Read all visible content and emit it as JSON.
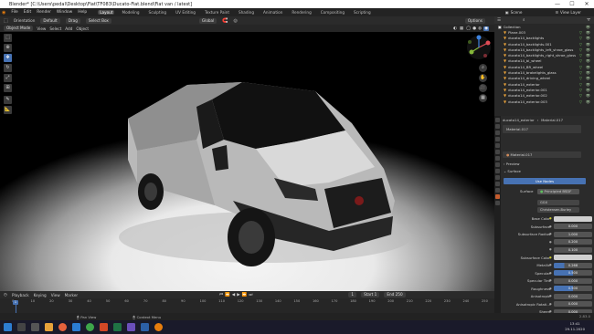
{
  "titlebar": {
    "title": "Blender* [C:\\Users\\pedal\\Desktop\\Fiat\\TF083\\Ducato-Fiat.blend\\Fiat van / latest]",
    "min": "—",
    "max": "☐",
    "close": "✕"
  },
  "menu": [
    "File",
    "Edit",
    "Render",
    "Window",
    "Help"
  ],
  "workspaces": [
    "Layout",
    "Modeling",
    "Sculpting",
    "UV Editing",
    "Texture Paint",
    "Shading",
    "Animation",
    "Rendering",
    "Compositing",
    "Scripting"
  ],
  "active_workspace": "Layout",
  "scene": {
    "label": "Scene",
    "view_layer": "View Layer"
  },
  "viewport_header": {
    "mode": "Object Mode",
    "menus": [
      "View",
      "Select",
      "Add",
      "Object"
    ],
    "orientation": "Orientation",
    "default": "Default",
    "drag": "Drag",
    "select_box": "Select Box",
    "transform": "Global",
    "options": "Options"
  },
  "toolbar_icons": [
    "cursor-icon",
    "move-icon",
    "rotate-icon",
    "scale-icon",
    "transform-icon",
    "annotate-icon",
    "measure-icon"
  ],
  "outliner": {
    "title": "Collection",
    "items": [
      "Plane.003",
      "ducato14_backlights",
      "ducato14_backlights.001",
      "ducato14_backlights_left_shroe_glass",
      "ducato14_backlights_right_shroe_glass",
      "ducato14_bl_wheel",
      "ducato14_BR_wheel",
      "ducato14_brakelights_glass",
      "ducato14_driving_wheel",
      "ducato14_exterior",
      "ducato14_exterior.001",
      "ducato14_exterior.002",
      "ducato14_exterior.003"
    ]
  },
  "properties": {
    "object_name": "ducato14_exterior",
    "material_slot": "Material.017",
    "slot_list": "Material.017",
    "material_name": "Material.017",
    "sections": [
      "Preview",
      "Surface"
    ],
    "use_nodes": "Use Nodes",
    "surface_label": "Surface",
    "surface_value": "Principled BSDF",
    "distribution": "GGX",
    "subsurface_method": "Christensen-Burley",
    "rows": [
      {
        "label": "Base Color",
        "value": "",
        "kind": "white"
      },
      {
        "label": "Subsurface",
        "value": "0.000",
        "kind": "gray"
      },
      {
        "label": "Subsurface Radius",
        "value": "1.000",
        "kind": "gray"
      },
      {
        "label": "",
        "value": "0.200",
        "kind": "gray"
      },
      {
        "label": "",
        "value": "0.100",
        "kind": "gray"
      },
      {
        "label": "Subsurface Color",
        "value": "",
        "kind": "white"
      },
      {
        "label": "Metallic",
        "value": "0.268",
        "kind": "blue",
        "fill": 0.268
      },
      {
        "label": "Specular",
        "value": "0.500",
        "kind": "blue",
        "fill": 0.5
      },
      {
        "label": "Specular Tint",
        "value": "0.000",
        "kind": "gray"
      },
      {
        "label": "Roughness",
        "value": "0.500",
        "kind": "blue",
        "fill": 0.5
      },
      {
        "label": "Anisotropic",
        "value": "0.000",
        "kind": "gray"
      },
      {
        "label": "Anisotropic Rotati...",
        "value": "0.000",
        "kind": "gray"
      },
      {
        "label": "Sheen",
        "value": "0.000",
        "kind": "gray"
      }
    ]
  },
  "timeline": {
    "menus": [
      "Playback",
      "Keying",
      "View",
      "Marker"
    ],
    "current_frame": "1",
    "start_label": "Start",
    "start": "1",
    "end_label": "End",
    "end": "250",
    "ticks": [
      "0",
      "10",
      "20",
      "30",
      "40",
      "50",
      "60",
      "70",
      "80",
      "90",
      "100",
      "110",
      "120",
      "130",
      "140",
      "150",
      "160",
      "170",
      "180",
      "190",
      "200",
      "210",
      "220",
      "230",
      "240",
      "250"
    ]
  },
  "statusbar": {
    "pan_view": "Pan View",
    "context_menu": "Context Menu",
    "version": "2.83.0"
  },
  "taskbar": {
    "time": "13:41",
    "date": "29.11.2020"
  },
  "colors": {
    "accent": "#4772b3",
    "active_tab": "#c35b2d",
    "object_orange": "#e8a23a"
  }
}
